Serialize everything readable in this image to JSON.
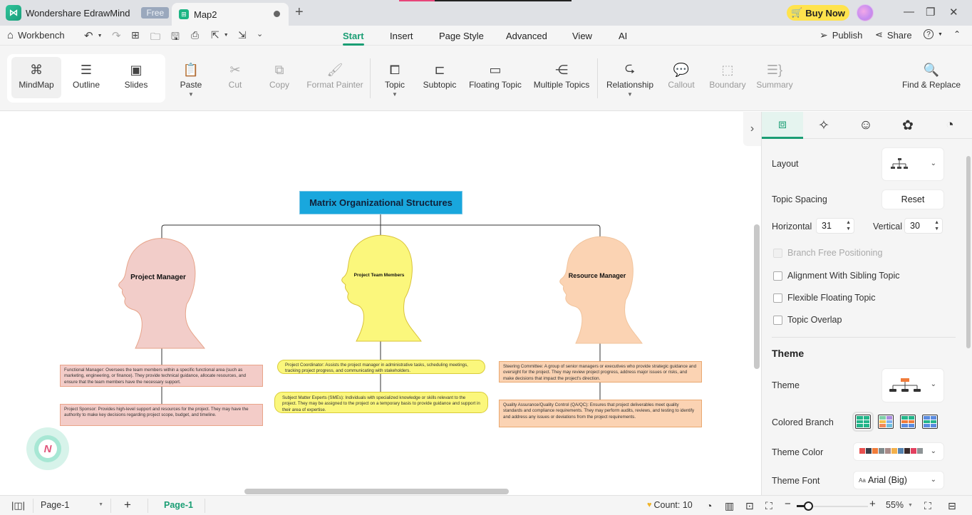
{
  "titlebar": {
    "app_name": "Wondershare EdrawMind",
    "plan_badge": "Free",
    "doc_tab": "Map2",
    "new_tab_icon": "+",
    "buy_now": "Buy Now",
    "minimize": "—",
    "restore": "❐",
    "close": "✕"
  },
  "quickbar": {
    "workbench": "Workbench",
    "menu_tabs": [
      "Start",
      "Insert",
      "Page Style",
      "Advanced",
      "View",
      "AI"
    ],
    "active_tab": "Start",
    "publish": "Publish",
    "share": "Share",
    "help": "?"
  },
  "ribbon": {
    "views": [
      {
        "label": "MindMap",
        "icon": "mindmap-icon",
        "active": true
      },
      {
        "label": "Outline",
        "icon": "outline-icon",
        "active": false
      },
      {
        "label": "Slides",
        "icon": "slides-icon",
        "active": false
      }
    ],
    "clipboard": [
      {
        "label": "Paste",
        "icon": "paste-icon",
        "disabled": false,
        "dropdown": true
      },
      {
        "label": "Cut",
        "icon": "cut-icon",
        "disabled": true
      },
      {
        "label": "Copy",
        "icon": "copy-icon",
        "disabled": true
      },
      {
        "label": "Format Painter",
        "icon": "format-painter-icon",
        "disabled": true
      }
    ],
    "insert": [
      {
        "label": "Topic",
        "icon": "topic-icon",
        "disabled": false,
        "dropdown": true
      },
      {
        "label": "Subtopic",
        "icon": "subtopic-icon",
        "disabled": false
      },
      {
        "label": "Floating Topic",
        "icon": "floating-topic-icon",
        "disabled": false
      },
      {
        "label": "Multiple Topics",
        "icon": "multiple-topics-icon",
        "disabled": false
      }
    ],
    "elements": [
      {
        "label": "Relationship",
        "icon": "relationship-icon",
        "disabled": false,
        "dropdown": true
      },
      {
        "label": "Callout",
        "icon": "callout-icon",
        "disabled": true
      },
      {
        "label": "Boundary",
        "icon": "boundary-icon",
        "disabled": true
      },
      {
        "label": "Summary",
        "icon": "summary-icon",
        "disabled": true
      }
    ],
    "find_replace": "Find & Replace"
  },
  "mindmap": {
    "root": "Matrix Organizational Structures",
    "branches": [
      {
        "title": "Project Manager",
        "color": "#f2cdc9",
        "details": [
          "Functional Manager: Oversees the team members within a specific functional area (such as marketing, engineering, or finance). They provide technical guidance, allocate resources, and ensure that the team members have the necessary support.",
          "Project Sponsor: Provides high-level support and resources for the project. They may have the authority to make key decisions regarding project scope, budget, and timeline."
        ]
      },
      {
        "title": "Project Team Members",
        "color": "#fbf77c",
        "details": [
          "Project Coordinator: Assists the project manager in administrative tasks, scheduling meetings, tracking project progress, and communicating with stakeholders.",
          "Subject Matter Experts (SMEs): Individuals with specialized knowledge or skills relevant to the project. They may be assigned to the project on a temporary basis to provide guidance and support in their area of expertise."
        ]
      },
      {
        "title": "Resource Manager",
        "color": "#fbd3b3",
        "details": [
          "Steering Committee: A group of senior managers or executives who provide strategic guidance and oversight for the project. They may review project progress, address major issues or risks, and make decisions that impact the project's direction.",
          "Quality Assurance/Quality Control (QA/QC): Ensures that project deliverables meet quality standards and compliance requirements. They may perform audits, reviews, and testing to identify and address any issues or deviations from the project requirements."
        ]
      }
    ]
  },
  "panel": {
    "tabs": [
      "layout-icon",
      "ai-style-icon",
      "emoji-marker-icon",
      "theme-flower-icon",
      "history-clock-icon"
    ],
    "layout_label": "Layout",
    "topic_spacing_label": "Topic Spacing",
    "reset": "Reset",
    "horizontal_label": "Horizontal",
    "horizontal_value": "31",
    "vertical_label": "Vertical",
    "vertical_value": "30",
    "checks": [
      {
        "label": "Branch Free Positioning",
        "checked": false,
        "disabled": true
      },
      {
        "label": "Alignment With Sibling Topic",
        "checked": false,
        "disabled": false
      },
      {
        "label": "Flexible Floating Topic",
        "checked": false,
        "disabled": false
      },
      {
        "label": "Topic Overlap",
        "checked": false,
        "disabled": false
      }
    ],
    "theme_section": "Theme",
    "theme_label": "Theme",
    "colored_branch_label": "Colored Branch",
    "theme_color_label": "Theme Color",
    "theme_colors": [
      "#e8504f",
      "#3a3f4a",
      "#f07c3a",
      "#7f8a8c",
      "#a98b88",
      "#f3b04b",
      "#5683b0",
      "#3b2a2a",
      "#e2405f",
      "#8e9496"
    ],
    "theme_font_label": "Theme Font",
    "theme_font_value": "Arial (Big)",
    "theme_font_prefix": "Aa"
  },
  "statusbar": {
    "page_select": "Page-1",
    "add_page": "+",
    "active_page": "Page-1",
    "count": "Count: 10",
    "zoom_level_percent": 55,
    "zoom_label": "55%"
  }
}
